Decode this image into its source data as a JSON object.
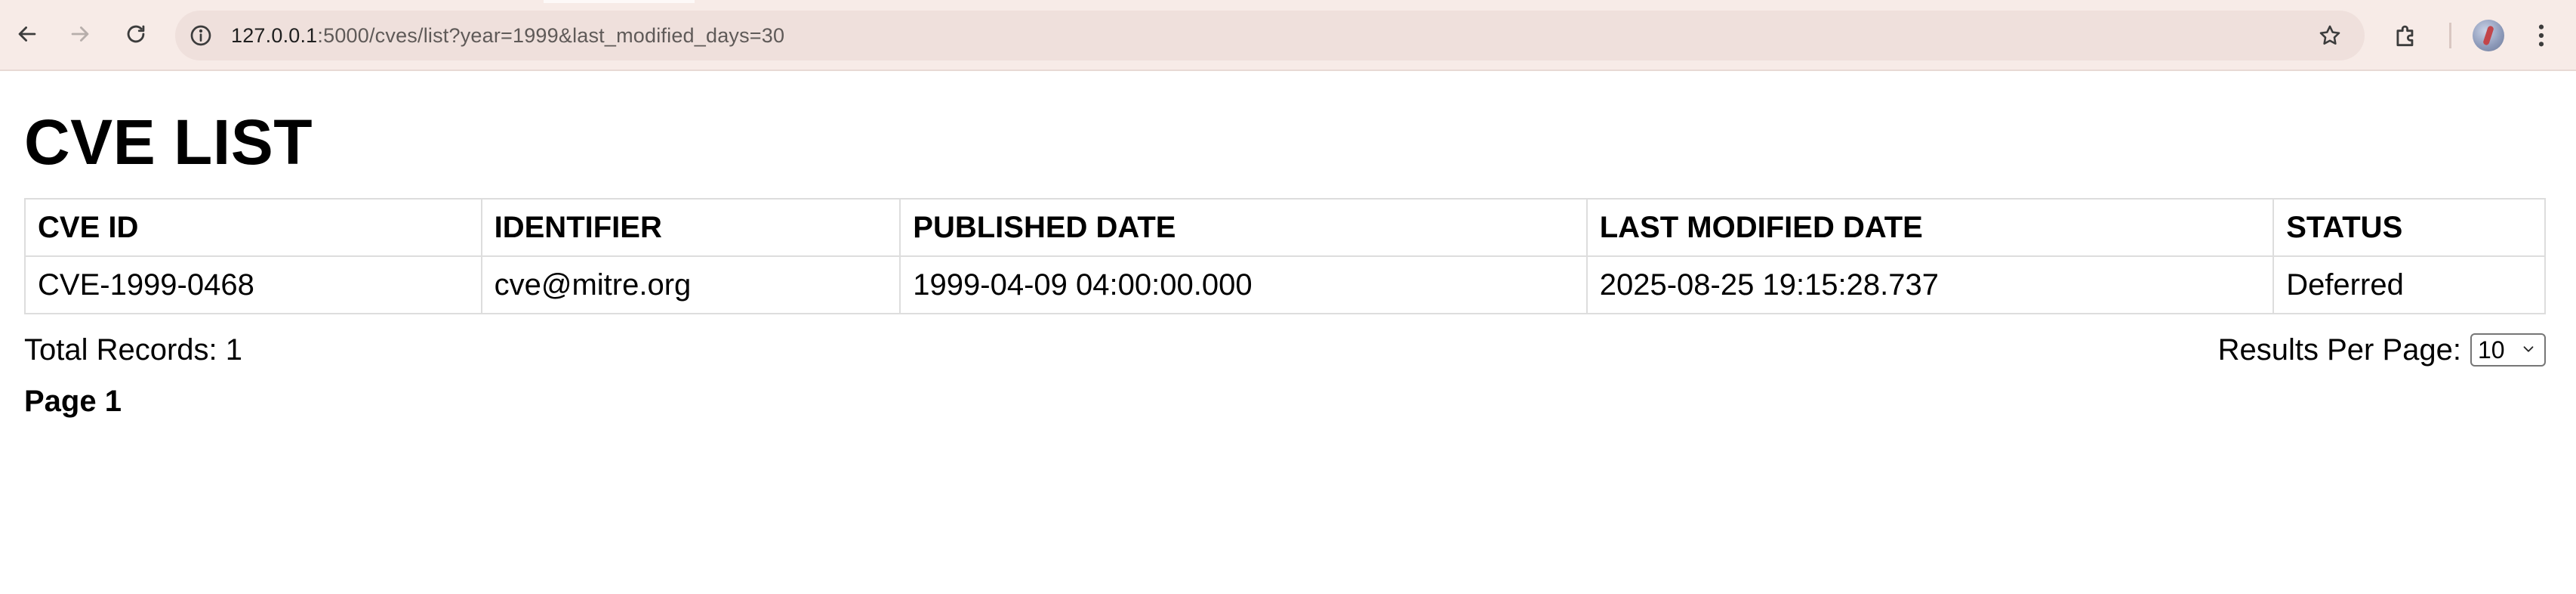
{
  "browser": {
    "url_host": "127.0.0.1",
    "url_rest": ":5000/cves/list?year=1999&last_modified_days=30"
  },
  "page": {
    "title": "CVE LIST",
    "table": {
      "headers": [
        "CVE ID",
        "IDENTIFIER",
        "PUBLISHED DATE",
        "LAST MODIFIED DATE",
        "STATUS"
      ],
      "rows": [
        [
          "CVE-1999-0468",
          "cve@mitre.org",
          "1999-04-09 04:00:00.000",
          "2025-08-25 19:15:28.737",
          "Deferred"
        ]
      ]
    },
    "total_records": "Total Records: 1",
    "results_per_page_label": "Results Per Page:",
    "results_per_page_value": "10",
    "page_label": "Page 1"
  }
}
